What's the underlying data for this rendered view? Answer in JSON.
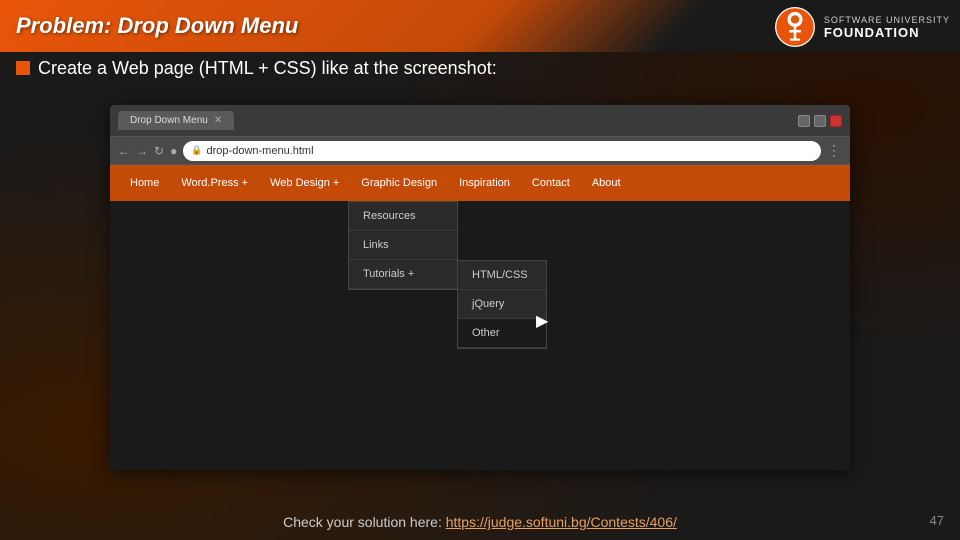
{
  "header": {
    "title": "Problem: Drop Down Menu"
  },
  "logo": {
    "top_text": "SOFTWARE UNIVERSITY",
    "bottom_text": "FOUNDATION"
  },
  "bullet": {
    "text": "Create a Web page (HTML + CSS) like at the screenshot:"
  },
  "browser": {
    "tab_label": "Drop Down Menu",
    "url": "drop-down-menu.html"
  },
  "nav": {
    "items": [
      "Home",
      "Word.Press +",
      "Web Design +",
      "Graphic Design",
      "Inspiration",
      "Contact",
      "About"
    ]
  },
  "web_design_dropdown": {
    "items": [
      "Resources",
      "Links",
      "Tutorials +"
    ]
  },
  "tutorials_submenu": {
    "items": [
      "HTML/CSS",
      "jQuery",
      "Other"
    ]
  },
  "footer": {
    "text": "Check your solution here: ",
    "link_text": "https://judge.softuni.bg/Contests/406/",
    "link_url": "https://judge.softuni.bg/Contests/406/"
  },
  "slide_number": "47"
}
